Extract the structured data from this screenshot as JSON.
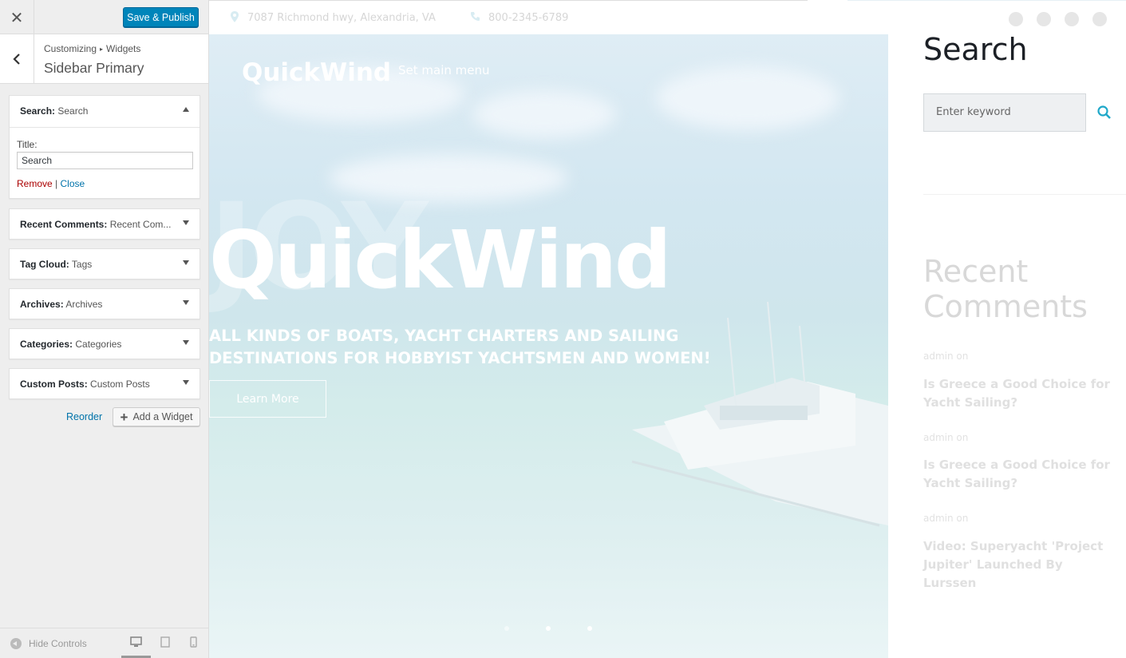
{
  "panel": {
    "close_glyph": "✕",
    "save_label": "Save & Publish",
    "breadcrumb": [
      "Customizing",
      "Widgets"
    ],
    "section_title": "Sidebar Primary",
    "widgets": [
      {
        "type": "Search",
        "name": "Search",
        "open": true
      },
      {
        "type": "Recent Comments",
        "name": "Recent Com..."
      },
      {
        "type": "Tag Cloud",
        "name": "Tags"
      },
      {
        "type": "Archives",
        "name": "Archives"
      },
      {
        "type": "Categories",
        "name": "Categories"
      },
      {
        "type": "Custom Posts",
        "name": "Custom Posts"
      }
    ],
    "search_widget": {
      "title_label": "Title:",
      "title_value": "Search",
      "remove_label": "Remove",
      "separator": "|",
      "close_label": "Close"
    },
    "reorder_label": "Reorder",
    "add_widget_label": "Add a Widget",
    "hide_controls_label": "Hide Controls",
    "colors": {
      "primary": "#0085ba",
      "link": "#0073aa",
      "danger": "#a00"
    }
  },
  "preview": {
    "topbar": {
      "address": "7087 Richmond hwy, Alexandria, VA",
      "phone": "800-2345-6789",
      "social": [
        "facebook-icon",
        "twitter-icon",
        "google-plus-icon",
        "instagram-icon"
      ]
    },
    "logo": "QuickWind",
    "menu_placeholder": "Set main menu",
    "hero": {
      "title": "QuickWind",
      "subtitle": "ALL KINDS OF BOATS, YACHT CHARTERS AND SAILING DESTINATIONS FOR HOBBYIST YACHTSMEN AND WOMEN!",
      "button": "Learn More",
      "slides": 3
    },
    "sidebar": {
      "search_title": "Search",
      "search_placeholder": "Enter keyword",
      "recent_title": "Recent Comments",
      "comments": [
        {
          "meta": "admin on",
          "post": "Is Greece a Good Choice for Yacht Sailing?"
        },
        {
          "meta": "admin on",
          "post": "Is Greece a Good Choice for Yacht Sailing?"
        },
        {
          "meta": "admin on",
          "post": "Video: Superyacht 'Project Jupiter' Launched By Lurssen"
        }
      ]
    },
    "colors": {
      "accent": "#1fa8c9"
    }
  }
}
